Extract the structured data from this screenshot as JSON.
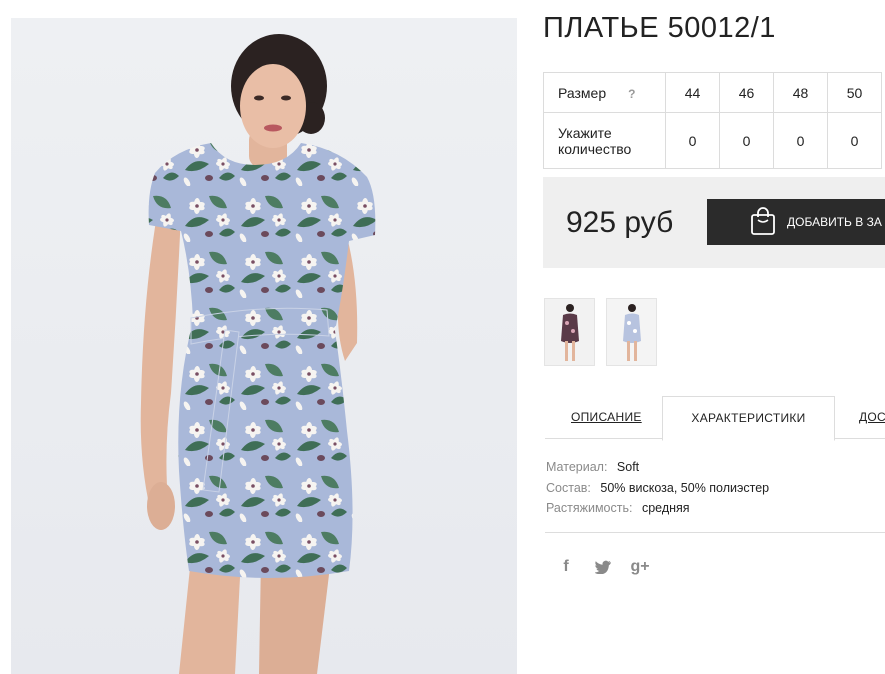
{
  "product": {
    "title": "ПЛАТЬЕ 50012/1",
    "size_label": "Размер",
    "size_help": "?",
    "sizes": [
      "44",
      "46",
      "48",
      "50"
    ],
    "qty_label": "Укажите количество",
    "quantities": [
      "0",
      "0",
      "0",
      "0"
    ],
    "price": "925 руб",
    "cart_button": "ДОБАВИТЬ В ЗА"
  },
  "tabs": [
    {
      "label": "ОПИСАНИЕ"
    },
    {
      "label": "ХАРАКТЕРИСТИКИ"
    },
    {
      "label": "ДОСТ"
    }
  ],
  "specs": [
    {
      "key": "Материал:",
      "value": "Soft"
    },
    {
      "key": "Состав:",
      "value": "50% вискоза, 50% полиэстер"
    },
    {
      "key": "Растяжимость:",
      "value": "средняя"
    }
  ],
  "social": {
    "facebook": "f",
    "google": "g+"
  },
  "icons": {
    "cart": "shopping-bag-icon",
    "facebook": "facebook-icon",
    "twitter": "twitter-icon",
    "google": "google-plus-icon"
  },
  "colors": {
    "button_bg": "#2b2b2b",
    "price_bg": "#efefef",
    "dress_base": "#a9b8d9",
    "leaf": "#3f6e56",
    "flower": "#f6f4f1"
  }
}
